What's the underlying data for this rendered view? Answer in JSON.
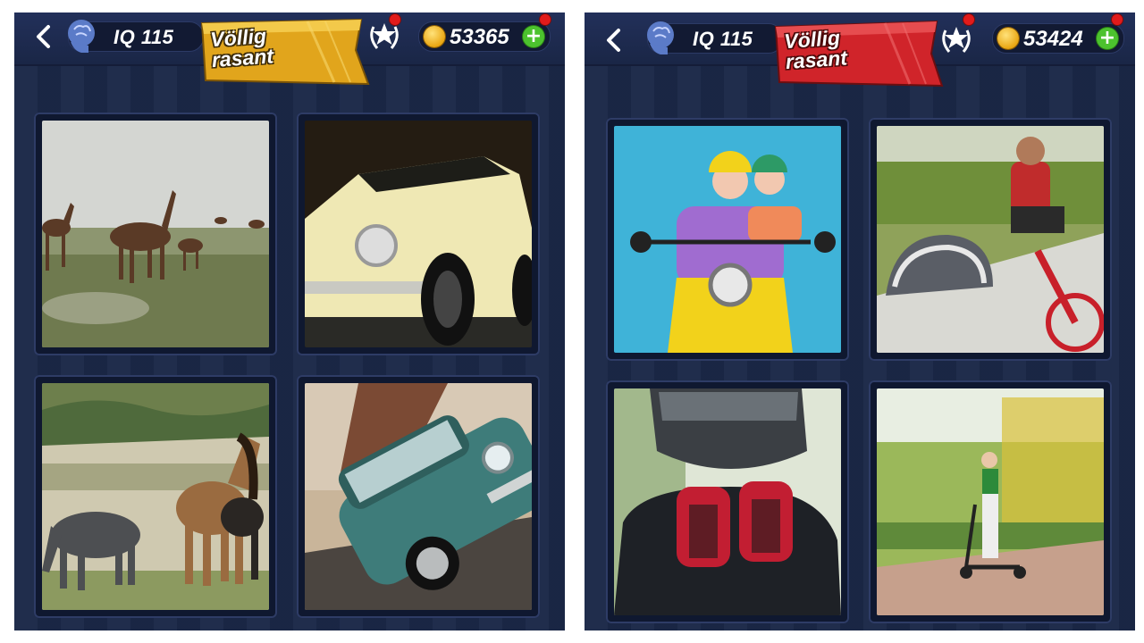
{
  "screens": [
    {
      "iq_label": "IQ 115",
      "level_banner": [
        "Völlig",
        "rasant"
      ],
      "banner_color": "#e1a51c",
      "coins": "53365",
      "images": [
        "horses-running-in-mist",
        "cream-vintage-muscle-car",
        "horses-grazing-in-pasture",
        "teal-classic-mustang"
      ]
    },
    {
      "iq_label": "IQ 115",
      "level_banner": [
        "Völlig",
        "rasant"
      ],
      "banner_color": "#d0242a",
      "coins": "53424",
      "images": [
        "elderly-couple-on-yellow-scooter",
        "bike-helmet-and-cyclist",
        "motorcyclist-gloves-helmet",
        "woman-on-electric-scooter"
      ]
    }
  ],
  "icons": {
    "back": "chevron-left-icon",
    "iq": "brain-head-icon",
    "award": "star-laurel-icon",
    "coin": "coin-icon",
    "add": "plus-icon"
  },
  "glyphs": {
    "back": "‹",
    "plus": "+"
  },
  "colors": {
    "panel": "#1b2848",
    "coin_plus": "#4cc22e",
    "notification": "#e11b1b"
  }
}
